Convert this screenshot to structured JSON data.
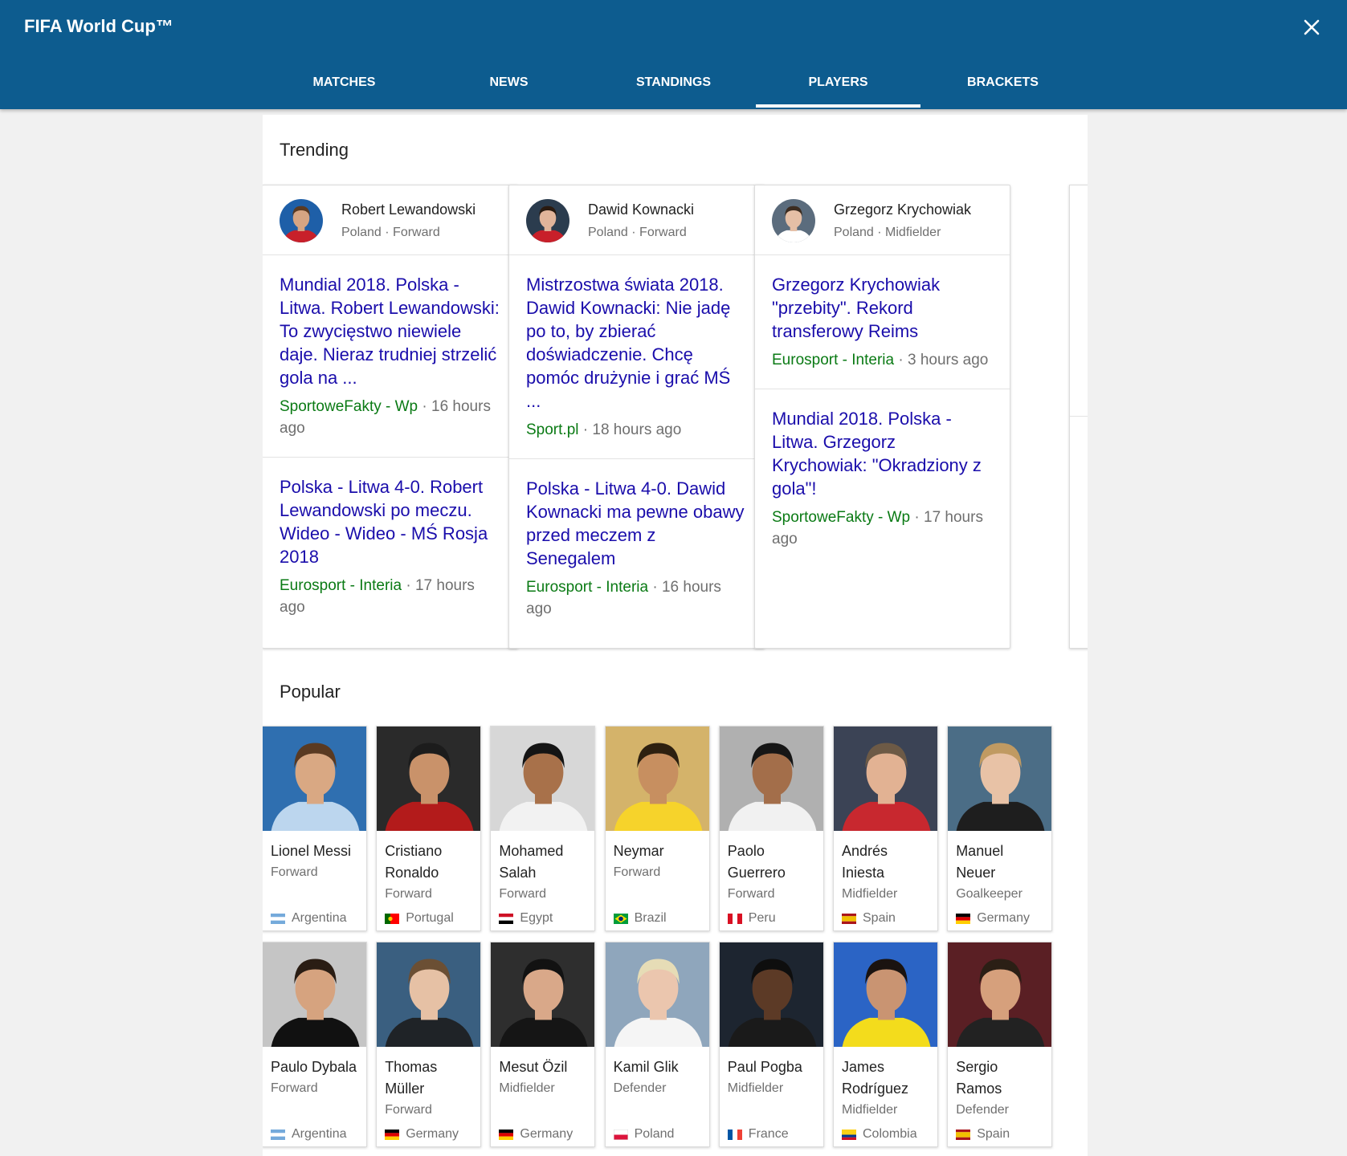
{
  "app": {
    "title": "FIFA World Cup™"
  },
  "tabs": [
    {
      "label": "MATCHES"
    },
    {
      "label": "NEWS"
    },
    {
      "label": "STANDINGS"
    },
    {
      "label": "PLAYERS",
      "active": true
    },
    {
      "label": "BRACKETS"
    }
  ],
  "trending": {
    "title": "Trending",
    "cards": [
      {
        "name": "Robert Lewandowski",
        "subtitle": "Poland · Forward",
        "articles": [
          {
            "headline": "Mundial 2018. Polska - Litwa. Robert Lewandowski: To zwycięstwo niewiele daje. Nieraz trudniej strzelić gola na ...",
            "source": "SportoweFakty - Wp",
            "time": "16 hours ago"
          },
          {
            "headline": "Polska - Litwa 4-0. Robert Lewandowski po meczu. Wideo - Wideo - MŚ Rosja 2018",
            "source": "Eurosport - Interia",
            "time": "17 hours ago"
          }
        ]
      },
      {
        "name": "Dawid Kownacki",
        "subtitle": "Poland · Forward",
        "articles": [
          {
            "headline": "Mistrzostwa świata 2018. Dawid Kownacki: Nie jadę po to, by zbierać doświadczenie. Chcę pomóc drużynie i grać MŚ ...",
            "source": "Sport.pl",
            "time": "18 hours ago"
          },
          {
            "headline": "Polska - Litwa 4-0. Dawid Kownacki ma pewne obawy przed meczem z Senegalem",
            "source": "Eurosport - Interia",
            "time": "16 hours ago"
          }
        ]
      },
      {
        "name": "Grzegorz Krychowiak",
        "subtitle": "Poland · Midfielder",
        "articles": [
          {
            "headline": "Grzegorz Krychowiak \"przebity\". Rekord transferowy Reims",
            "source": "Eurosport - Interia",
            "time": "3 hours ago"
          },
          {
            "headline": "Mundial 2018. Polska - Litwa. Grzegorz Krychowiak: \"Okradziony z gola\"!",
            "source": "SportoweFakty - Wp",
            "time": "17 hours ago"
          }
        ]
      }
    ]
  },
  "popular": {
    "title": "Popular",
    "players": [
      {
        "name": "Lionel Messi",
        "position": "Forward",
        "country": "Argentina"
      },
      {
        "name": "Cristiano Ronaldo",
        "position": "Forward",
        "country": "Portugal"
      },
      {
        "name": "Mohamed Salah",
        "position": "Forward",
        "country": "Egypt"
      },
      {
        "name": "Neymar",
        "position": "Forward",
        "country": "Brazil"
      },
      {
        "name": "Paolo Guerrero",
        "position": "Forward",
        "country": "Peru"
      },
      {
        "name": "Andrés Iniesta",
        "position": "Midfielder",
        "country": "Spain"
      },
      {
        "name": "Manuel Neuer",
        "position": "Goalkeeper",
        "country": "Germany"
      },
      {
        "name": "Paulo Dybala",
        "position": "Forward",
        "country": "Argentina"
      },
      {
        "name": "Thomas Müller",
        "position": "Forward",
        "country": "Germany"
      },
      {
        "name": "Mesut Özil",
        "position": "Midfielder",
        "country": "Germany"
      },
      {
        "name": "Kamil Glik",
        "position": "Defender",
        "country": "Poland"
      },
      {
        "name": "Paul Pogba",
        "position": "Midfielder",
        "country": "France"
      },
      {
        "name": "James Rodríguez",
        "position": "Midfielder",
        "country": "Colombia"
      },
      {
        "name": "Sergio Ramos",
        "position": "Defender",
        "country": "Spain"
      }
    ]
  },
  "colors": {
    "header": "#0d5c8f",
    "headline_link": "#1a0dab",
    "source_link": "#0a7a14",
    "muted": "#6f6f6f"
  }
}
